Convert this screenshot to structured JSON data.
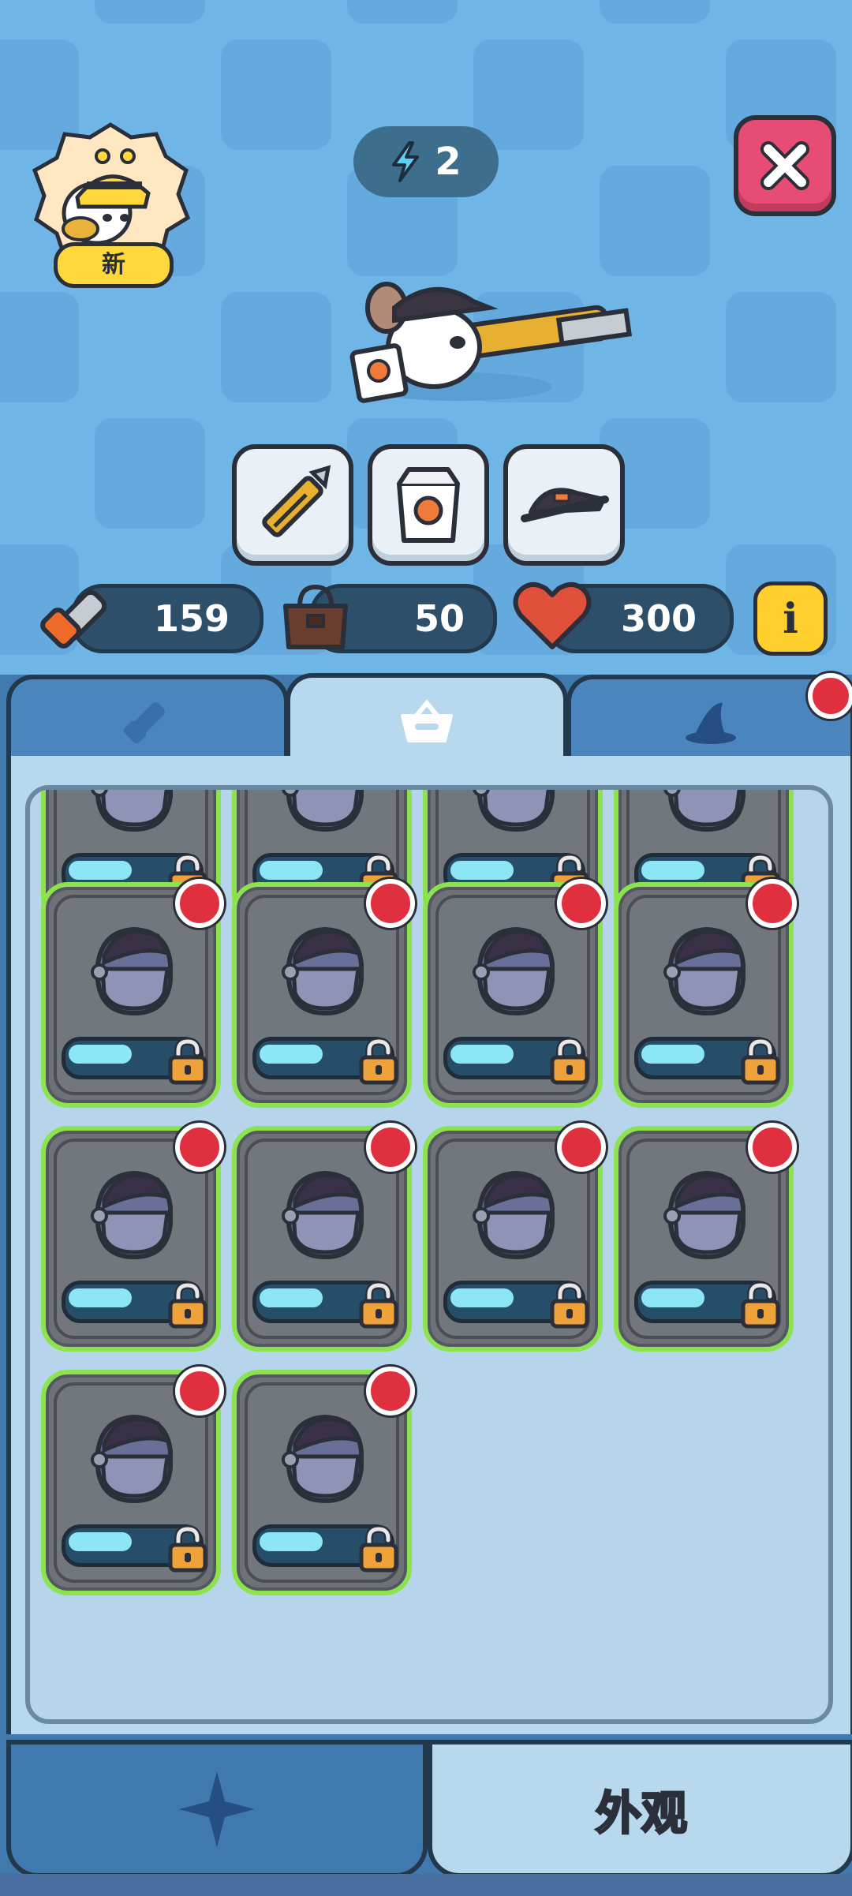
{
  "header": {
    "avatar_badge": "新",
    "energy": {
      "icon": "lightning-icon",
      "value": "2"
    },
    "close_icon": "close-icon"
  },
  "equipment": {
    "slots": [
      {
        "icon": "box-cutter-icon"
      },
      {
        "icon": "takeout-box-icon"
      },
      {
        "icon": "cap-icon"
      }
    ]
  },
  "stats": [
    {
      "icon": "chainsaw-icon",
      "value": "159"
    },
    {
      "icon": "bag-icon",
      "value": "50"
    },
    {
      "icon": "heart-icon",
      "value": "300"
    }
  ],
  "info_icon": "info-icon",
  "tabs": [
    {
      "icon": "chainsaw-tab-icon",
      "active": false,
      "notify": false
    },
    {
      "icon": "basket-tab-icon",
      "active": true,
      "notify": false
    },
    {
      "icon": "witch-hat-tab-icon",
      "active": false,
      "notify": true
    }
  ],
  "grid": {
    "item_icon": "visor-helmet-icon",
    "items": [
      {
        "progress": 0.5,
        "locked": true,
        "notify": false
      },
      {
        "progress": 0.5,
        "locked": true,
        "notify": false
      },
      {
        "progress": 0.5,
        "locked": true,
        "notify": false
      },
      {
        "progress": 0.5,
        "locked": true,
        "notify": false
      },
      {
        "progress": 0.5,
        "locked": true,
        "notify": true
      },
      {
        "progress": 0.5,
        "locked": true,
        "notify": true
      },
      {
        "progress": 0.5,
        "locked": true,
        "notify": true
      },
      {
        "progress": 0.5,
        "locked": true,
        "notify": true
      },
      {
        "progress": 0.5,
        "locked": true,
        "notify": true
      },
      {
        "progress": 0.5,
        "locked": true,
        "notify": true
      },
      {
        "progress": 0.5,
        "locked": true,
        "notify": true
      },
      {
        "progress": 0.5,
        "locked": true,
        "notify": true
      },
      {
        "progress": 0.5,
        "locked": true,
        "notify": true
      },
      {
        "progress": 0.5,
        "locked": true,
        "notify": true
      }
    ]
  },
  "bottom_tabs": [
    {
      "icon": "star-compass-icon",
      "label": "",
      "active": false
    },
    {
      "icon": "",
      "label": "外观",
      "active": true
    }
  ]
}
